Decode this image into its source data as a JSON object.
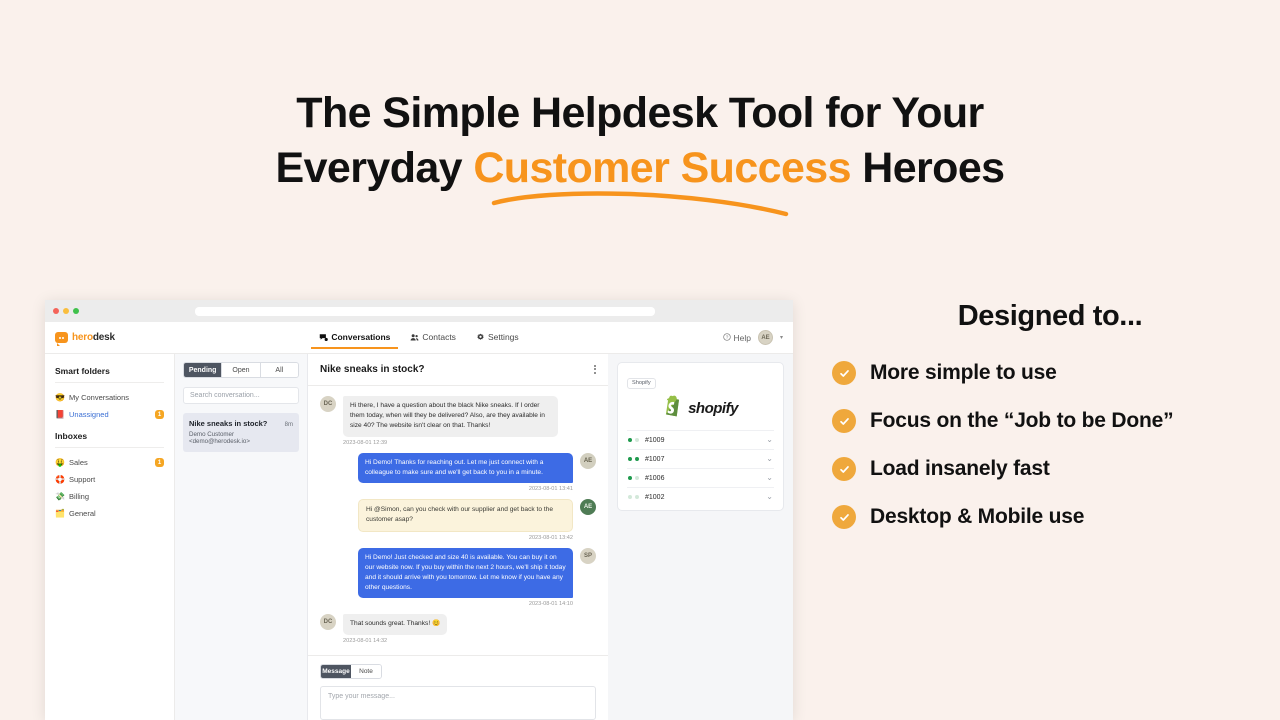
{
  "page": {
    "background_color": "#FAF1EC",
    "accent_color": "#F7941D",
    "headline_line1": "The Simple Helpdesk Tool for Your",
    "headline_line2_pre": "Everyday ",
    "headline_line2_accent": "Customer Success",
    "headline_line2_post": " Heroes"
  },
  "right_column": {
    "title": "Designed to...",
    "features": [
      {
        "label": "More simple to use"
      },
      {
        "label": "Focus on the “Job to be Done”"
      },
      {
        "label": "Load insanely fast"
      },
      {
        "label": "Desktop & Mobile use"
      }
    ]
  },
  "app": {
    "logo": {
      "hero": "hero",
      "desk": "desk"
    },
    "nav": [
      {
        "label": "Conversations",
        "icon": "chat-icon",
        "active": true
      },
      {
        "label": "Contacts",
        "icon": "contacts-icon",
        "active": false
      },
      {
        "label": "Settings",
        "icon": "gear-icon",
        "active": false
      }
    ],
    "help_label": "Help",
    "account_initials": "AE",
    "sidebar": {
      "smart_folders_heading": "Smart folders",
      "smart_folders": [
        {
          "label": "My Conversations",
          "emoji": "😎",
          "badge": ""
        },
        {
          "label": "Unassigned",
          "emoji": "📕",
          "badge": "1"
        }
      ],
      "inboxes_heading": "Inboxes",
      "inboxes": [
        {
          "label": "Sales",
          "emoji": "🤑",
          "badge": "1"
        },
        {
          "label": "Support",
          "emoji": "🛟",
          "badge": ""
        },
        {
          "label": "Billing",
          "emoji": "💸",
          "badge": ""
        },
        {
          "label": "General",
          "emoji": "🗂️",
          "badge": ""
        }
      ]
    },
    "conversation_list": {
      "filters": [
        {
          "label": "Pending",
          "active": true
        },
        {
          "label": "Open",
          "active": false
        },
        {
          "label": "All",
          "active": false
        }
      ],
      "search_placeholder": "Search conversation...",
      "items": [
        {
          "subject": "Nike sneaks in stock?",
          "time": "8m",
          "from": "Demo Customer <demo@herodesk.io>"
        }
      ]
    },
    "thread": {
      "title": "Nike sneaks in stock?",
      "messages": [
        {
          "initials": "DC",
          "side": "in",
          "kind": "grey",
          "text": "Hi there, I have a question about the black Nike sneaks. If I order them today, when will they be delivered? Also, are they available in size 40? The website isn't clear on that. Thanks!",
          "timestamp": "2023-08-01 12:39"
        },
        {
          "initials": "AE",
          "side": "out",
          "kind": "blue",
          "text": "Hi Demo! Thanks for reaching out. Let me just connect with a colleague to make sure and we'll get back to you in a minute.",
          "timestamp": "2023-08-01 13:41"
        },
        {
          "initials": "AE",
          "side": "out",
          "kind": "note",
          "text": "Hi @Simon, can you check with our supplier and get back to the customer asap?",
          "timestamp": "2023-08-01 13:42"
        },
        {
          "initials": "SP",
          "side": "out",
          "kind": "blue",
          "text": "Hi Demo! Just checked and size 40 is available. You can buy it on our website now. If you buy within the next 2 hours, we'll ship it today and it should arrive with you tomorrow. Let me know if you have any other questions.",
          "timestamp": "2023-08-01 14:10"
        },
        {
          "initials": "DC",
          "side": "in",
          "kind": "grey",
          "text": "That sounds great. Thanks! 😊",
          "timestamp": "2023-08-01 14:32"
        }
      ],
      "composer": {
        "tabs": [
          {
            "label": "Message",
            "active": true
          },
          {
            "label": "Note",
            "active": false
          }
        ],
        "placeholder": "Type your message..."
      }
    },
    "side_panel": {
      "chip": "Shopify",
      "brand": "shopify",
      "orders": [
        {
          "id": "#1009",
          "dots": [
            "on",
            "off"
          ]
        },
        {
          "id": "#1007",
          "dots": [
            "on",
            "on"
          ]
        },
        {
          "id": "#1006",
          "dots": [
            "on",
            "off"
          ]
        },
        {
          "id": "#1002",
          "dots": [
            "off",
            "off"
          ]
        }
      ]
    }
  }
}
